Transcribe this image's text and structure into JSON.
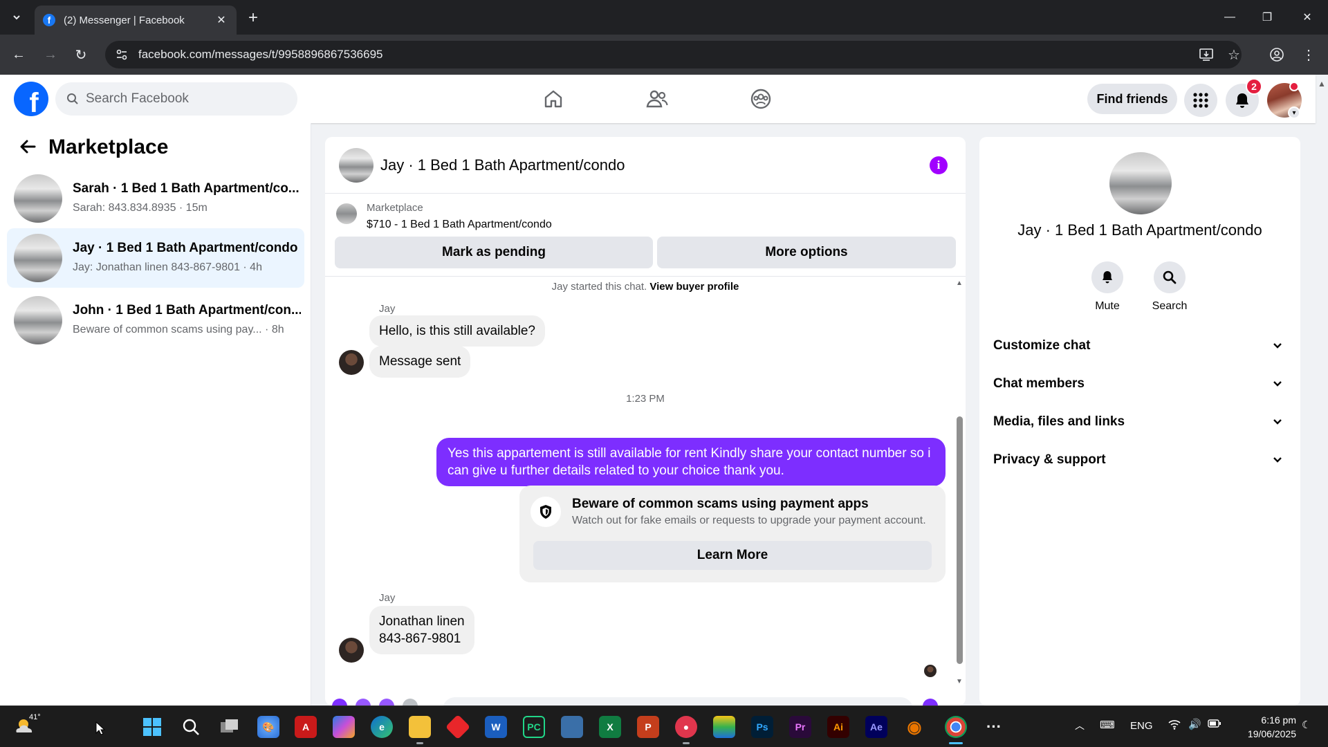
{
  "browser": {
    "tab_title": "(2) Messenger | Facebook",
    "url": "facebook.com/messages/t/9958896867536695"
  },
  "header": {
    "search_placeholder": "Search Facebook",
    "find_friends": "Find friends",
    "notification_count": "2"
  },
  "sidebar": {
    "title": "Marketplace",
    "conversations": [
      {
        "name": "Sarah · 1 Bed 1 Bath Apartment/co...",
        "preview": "Sarah: 843.834.8935 · 15m",
        "active": false
      },
      {
        "name": "Jay · 1 Bed 1 Bath Apartment/condo",
        "preview": "Jay: Jonathan linen 843-867-9801 · 4h",
        "active": true
      },
      {
        "name": "John · 1 Bed 1 Bath Apartment/con...",
        "preview": "Beware of common scams using pay...  · 8h",
        "active": false
      }
    ]
  },
  "chat": {
    "title": "Jay · 1 Bed 1 Bath Apartment/condo",
    "marketplace_label": "Marketplace",
    "listing": "$710 - 1 Bed 1 Bath Apartment/condo",
    "mark_pending": "Mark as pending",
    "more_options": "More options",
    "started_text": "Jay started this chat.",
    "view_profile": "View buyer profile",
    "sender_1": "Jay",
    "msg_1": "Hello, is this still available?",
    "msg_2": "Message sent",
    "time_sep": "1:23 PM",
    "msg_out": "Yes this appartement is still available for rent Kindly share your contact number so i can give u further details related to your choice thank you.",
    "scam_title": "Beware of common scams using payment apps",
    "scam_body": "Watch out for fake emails or requests to upgrade your payment account.",
    "learn_more": "Learn More",
    "sender_2": "Jay",
    "msg_3_line1": "Jonathan linen",
    "msg_3_line2": "843-867-9801"
  },
  "info_panel": {
    "name": "Jay · 1 Bed 1 Bath Apartment/condo",
    "mute": "Mute",
    "search": "Search",
    "sections": [
      "Customize chat",
      "Chat members",
      "Media, files and links",
      "Privacy & support"
    ]
  },
  "taskbar": {
    "temperature": "41°",
    "lang": "ENG",
    "time": "6:16 pm",
    "date": "19/06/2025"
  },
  "colors": {
    "brand": "#0866ff",
    "accent_purple": "#7d2eff",
    "info_purple": "#a100ff",
    "badge_red": "#e41e3f"
  }
}
